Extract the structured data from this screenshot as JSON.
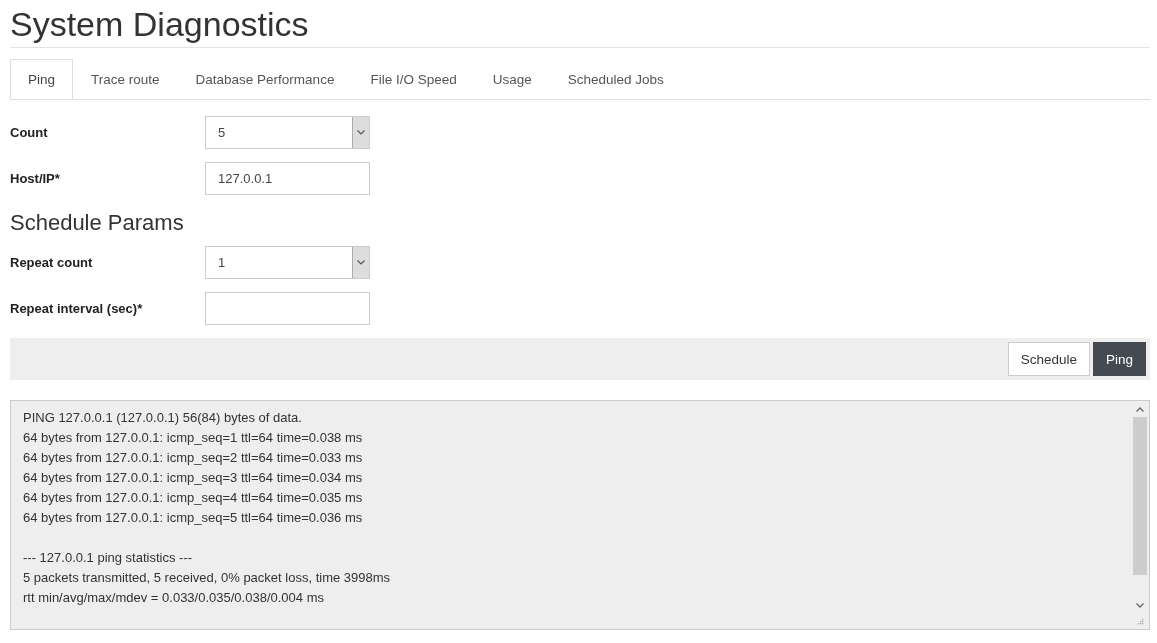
{
  "page_title": "System Diagnostics",
  "tabs": [
    {
      "label": "Ping",
      "selected": true
    },
    {
      "label": "Trace route",
      "selected": false
    },
    {
      "label": "Database Performance",
      "selected": false
    },
    {
      "label": "File I/O Speed",
      "selected": false
    },
    {
      "label": "Usage",
      "selected": false
    },
    {
      "label": "Scheduled Jobs",
      "selected": false
    }
  ],
  "fields": [
    {
      "label": "Count",
      "kind": "select",
      "value": "5"
    },
    {
      "label": "Host/IP*",
      "kind": "text",
      "value": "127.0.0.1"
    }
  ],
  "schedule": {
    "heading": "Schedule Params",
    "fields": [
      {
        "label": "Repeat count",
        "kind": "select",
        "value": "1"
      },
      {
        "label": "Repeat interval (sec)*",
        "kind": "text"
      }
    ]
  },
  "buttons": [
    {
      "label": "Schedule",
      "kind": "default"
    },
    {
      "label": "Ping",
      "kind": "primary"
    }
  ],
  "output": {
    "blocks": [
      [
        "PING 127.0.0.1 (127.0.0.1) 56(84) bytes of data.",
        "64 bytes from 127.0.0.1: icmp_seq=1 ttl=64 time=0.038 ms",
        "64 bytes from 127.0.0.1: icmp_seq=2 ttl=64 time=0.033 ms",
        "64 bytes from 127.0.0.1: icmp_seq=3 ttl=64 time=0.034 ms",
        "64 bytes from 127.0.0.1: icmp_seq=4 ttl=64 time=0.035 ms",
        "64 bytes from 127.0.0.1: icmp_seq=5 ttl=64 time=0.036 ms"
      ],
      [
        "--- 127.0.0.1 ping statistics ---",
        "5 packets transmitted, 5 received, 0% packet loss, time 3998ms",
        "rtt min/avg/max/mdev = 0.033/0.035/0.038/0.004 ms"
      ]
    ]
  }
}
